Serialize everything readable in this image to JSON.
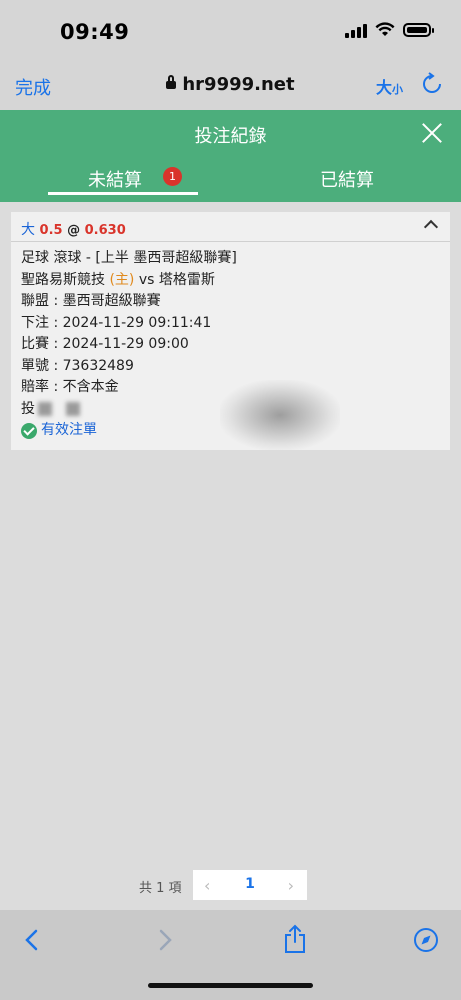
{
  "status": {
    "time": "09:49"
  },
  "browser": {
    "done_label": "完成",
    "url": "hr9999.net",
    "textsize_big": "大",
    "textsize_small": "小"
  },
  "header": {
    "title": "投注紀錄"
  },
  "tabs": [
    {
      "label": "未結算",
      "badge": "1",
      "active": true
    },
    {
      "label": "已結算",
      "active": false
    }
  ],
  "bet": {
    "type": "大",
    "handicap": "0.5",
    "at": "@",
    "odds": "0.630",
    "sport_line": "足球 滾球 - [上半 墨西哥超級聯賽]",
    "home_team": "聖路易斯競技",
    "home_tag": "(主)",
    "vs": "vs",
    "away_team": "塔格雷斯",
    "league": "聯盟 : 墨西哥超級聯賽",
    "placed": "下注 : 2024-11-29 09:11:41",
    "match_time": "比賽 : 2024-11-29 09:00",
    "ticket": "單號 : 73632489",
    "odds_type": "賠率 : 不含本金",
    "stake_prefix": "投",
    "status": "有效注單"
  },
  "pagination": {
    "total": "共 1 項",
    "prev": "‹",
    "page": "1",
    "next": "›"
  },
  "toolbar": {
    "icons": [
      "back-icon",
      "forward-icon",
      "share-icon",
      "compass-icon"
    ]
  }
}
